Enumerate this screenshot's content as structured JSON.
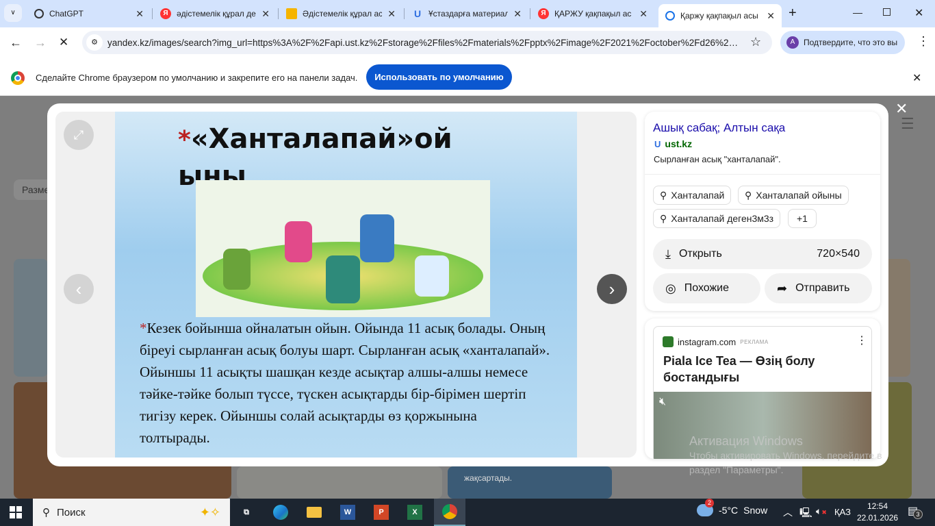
{
  "browser": {
    "tabs": [
      {
        "label": "ChatGPT",
        "icon": "chatgpt-icon"
      },
      {
        "label": "әдістемелік құрал де",
        "icon": "yandex-icon"
      },
      {
        "label": "Әдістемелік құрал ас",
        "icon": "image-icon"
      },
      {
        "label": "Ұстаздарға материал",
        "icon": "ust-icon"
      },
      {
        "label": "ҚАРЖУ қақпақыл ас",
        "icon": "yandex-icon"
      },
      {
        "label": "Қаржу қақпақыл асы",
        "icon": "loading-icon",
        "active": true
      }
    ],
    "new_tab": "+",
    "url": "yandex.kz/images/search?img_url=https%3A%2F%2Fapi.ust.kz%2Fstorage%2Ffiles%2Fmaterials%2Fpptx%2Fimage%2F2021%2Foctober%2Fd26%2F...",
    "profile_initial": "A",
    "profile_label": "Подтвердите, что это вы"
  },
  "infobar": {
    "text": "Сделайте Chrome браузером по умолчанию и закрепите его на панели задач.",
    "button": "Использовать по умолчанию"
  },
  "background": {
    "size_chip": "Разме"
  },
  "slide": {
    "title_line1": "«Ханталапай»ой",
    "title_line2": "ыны",
    "text": "Кезек бойынша ойналатын ойын. Ойында 11 асық болады. Оның біреуі сырланған асық болуы шарт. Сырланған асық «ханталапай». Ойыншы 11 асықты шашқан кезде асықтар алшы-алшы немесе тәйке-тәйке болып түссе, түскен асықтарды бір-бірімен шертіп тигізу керек. Ойыншы солай асықтарды өз қоржынына толтырады."
  },
  "panel": {
    "title": "Ашық сабақ; Алтын сақа",
    "source": "ust.kz",
    "description": "Сырланған асық \"ханталапай\".",
    "tags": [
      "Ханталапай",
      "Ханталапай ойыны",
      "Ханталапай деген3м3з"
    ],
    "more_tags": "+1",
    "open_label": "Открыть",
    "size": "720×540",
    "similar_label": "Похожие",
    "share_label": "Отправить"
  },
  "ad": {
    "domain": "instagram.com",
    "badge": "РЕКЛАМА",
    "title": "Piala Ice Tea — Өзің болу бостандығы"
  },
  "watermark": {
    "line1": "Активация Windows",
    "line2": "Чтобы активировать Windows, перейдите в",
    "line3": "раздел \"Параметры\"."
  },
  "thumb_caption": "жақсартады.",
  "taskbar": {
    "search": "Поиск",
    "weather_badge": "2",
    "temp": "-5°C",
    "weather": "Snow",
    "lang": "ҚАЗ",
    "time": "12:54",
    "date": "22.01.2026",
    "notif_count": "3"
  },
  "colors": {
    "accent": "#0b57d0",
    "link": "#1a0dab",
    "source": "#006600",
    "taskbar": "#1c2530"
  }
}
